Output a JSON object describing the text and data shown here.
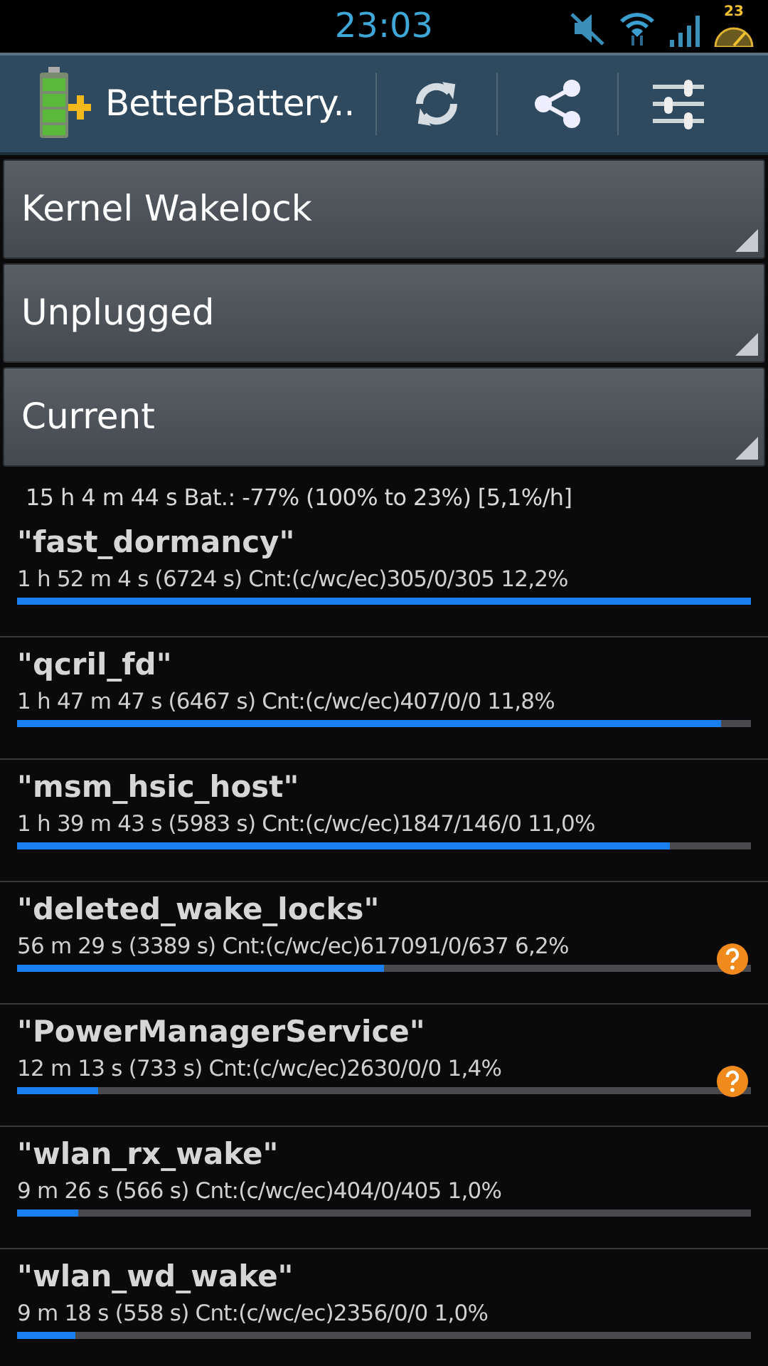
{
  "status_bar": {
    "time": "23:03",
    "battery_text": "23"
  },
  "action_bar": {
    "title": "BetterBattery.."
  },
  "spinners": [
    {
      "label": "Kernel Wakelock"
    },
    {
      "label": "Unplugged"
    },
    {
      "label": "Current"
    }
  ],
  "summary": "15 h 4 m 44 s  Bat.: -77% (100% to 23%) [5,1%/h]",
  "wakelocks": [
    {
      "name": "\"fast_dormancy\"",
      "details": "1 h 52 m 4 s  (6724 s) Cnt:(c/wc/ec)305/0/305 12,2%",
      "level": 1.0,
      "help": false
    },
    {
      "name": "\"qcril_fd\"",
      "details": "1 h 47 m 47 s  (6467 s) Cnt:(c/wc/ec)407/0/0 11,8%",
      "level": 0.96,
      "help": false
    },
    {
      "name": "\"msm_hsic_host\"",
      "details": "1 h 39 m 43 s  (5983 s) Cnt:(c/wc/ec)1847/146/0 11,0%",
      "level": 0.89,
      "help": false
    },
    {
      "name": "\"deleted_wake_locks\"",
      "details": "56 m 29 s  (3389 s) Cnt:(c/wc/ec)617091/0/637 6,2%",
      "level": 0.5,
      "help": true
    },
    {
      "name": "\"PowerManagerService\"",
      "details": "12 m 13 s  (733 s) Cnt:(c/wc/ec)2630/0/0 1,4%",
      "level": 0.11,
      "help": true
    },
    {
      "name": "\"wlan_rx_wake\"",
      "details": "9 m 26 s  (566 s) Cnt:(c/wc/ec)404/0/405 1,0%",
      "level": 0.083,
      "help": false
    },
    {
      "name": "\"wlan_wd_wake\"",
      "details": "9 m 18 s  (558 s) Cnt:(c/wc/ec)2356/0/0 1,0%",
      "level": 0.08,
      "help": false
    }
  ]
}
